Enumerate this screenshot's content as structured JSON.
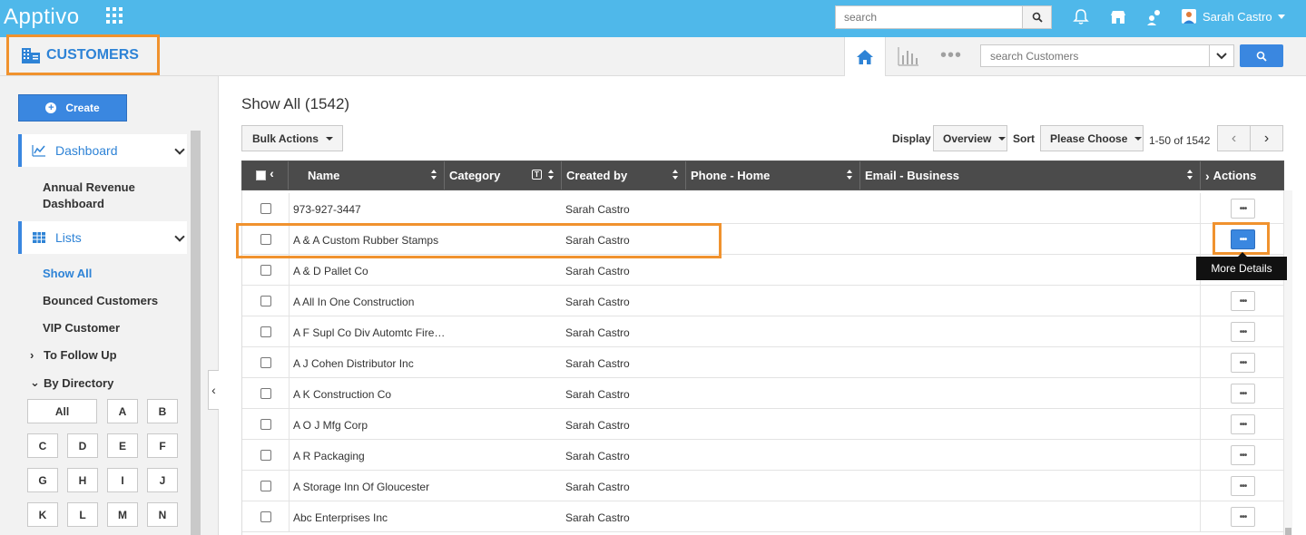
{
  "app": {
    "logo": "Apptivo",
    "search_placeholder": "search",
    "user_name": "Sarah Castro"
  },
  "module": {
    "title": "CUSTOMERS",
    "search_placeholder": "search Customers"
  },
  "sidebar": {
    "create_label": "Create",
    "dashboard_label": "Dashboard",
    "annual_revenue_label": "Annual Revenue Dashboard",
    "lists_label": "Lists",
    "list_items": [
      "Show All",
      "Bounced Customers",
      "VIP Customer"
    ],
    "to_follow_up": "To Follow Up",
    "by_directory": "By Directory",
    "directory": [
      "All",
      "A",
      "B",
      "C",
      "D",
      "E",
      "F",
      "G",
      "H",
      "I",
      "J",
      "K",
      "L",
      "M",
      "N"
    ]
  },
  "main": {
    "title": "Show All (1542)",
    "bulk_actions": "Bulk Actions",
    "display_label": "Display",
    "display_value": "Overview",
    "sort_label": "Sort",
    "sort_value": "Please Choose",
    "pager_text": "1-50 of 1542"
  },
  "table": {
    "columns": [
      "Name",
      "Category",
      "Created by",
      "Phone - Home",
      "Email - Business",
      "Actions"
    ],
    "rows": [
      {
        "name": "973-927-3447",
        "created_by": "Sarah Castro"
      },
      {
        "name": "A & A Custom Rubber Stamps",
        "created_by": "Sarah Castro"
      },
      {
        "name": "A & D Pallet Co",
        "created_by": "Sarah Castro"
      },
      {
        "name": "A All In One Construction",
        "created_by": "Sarah Castro"
      },
      {
        "name": "A F Supl Co Div Automtc Fire Protctn",
        "created_by": "Sarah Castro"
      },
      {
        "name": "A J Cohen Distributor Inc",
        "created_by": "Sarah Castro"
      },
      {
        "name": "A K Construction Co",
        "created_by": "Sarah Castro"
      },
      {
        "name": "A O J Mfg Corp",
        "created_by": "Sarah Castro"
      },
      {
        "name": "A R Packaging",
        "created_by": "Sarah Castro"
      },
      {
        "name": "A Storage Inn Of Gloucester",
        "created_by": "Sarah Castro"
      },
      {
        "name": "Abc Enterprises Inc",
        "created_by": "Sarah Castro"
      }
    ],
    "more_button": "•••",
    "tooltip": "More Details"
  },
  "colors": {
    "topbar": "#4fb8ea",
    "accent": "#3a87e0",
    "highlight": "#f0922e"
  }
}
